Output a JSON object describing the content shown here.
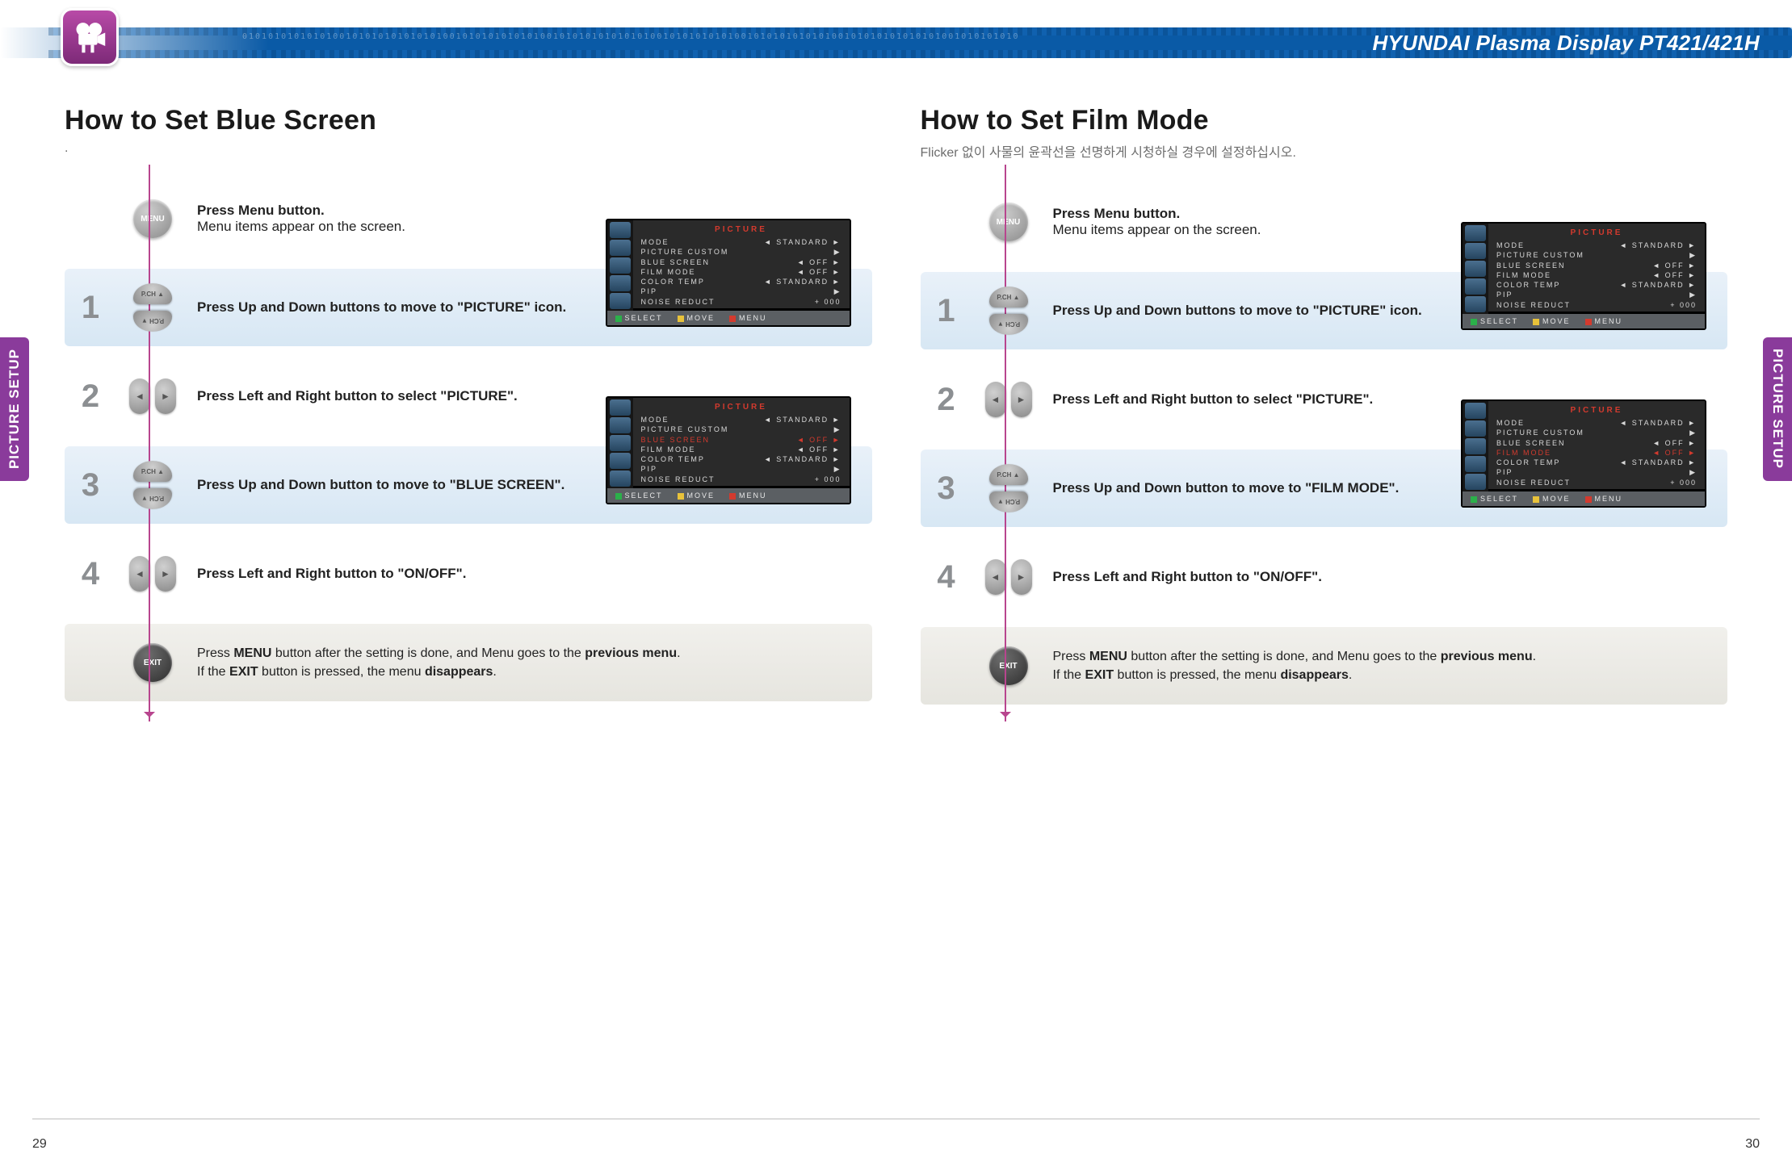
{
  "header": {
    "product_title": "HYUNDAI Plasma Display PT421/421H",
    "binary_decor": "010101010101010010101010101010100101010101010100101010101010101001010101010100101010101010100101010101010101001010101010"
  },
  "side_tab": {
    "label": "PICTURE SETUP"
  },
  "buttons": {
    "menu": "MENU",
    "exit": "EXIT",
    "pch_up": "P.CH ▲",
    "pch_down": "P.CH ▼",
    "left": "◄",
    "right": "►"
  },
  "osd": {
    "title": "PICTURE",
    "footer": {
      "select": "SELECT",
      "move": "MOVE",
      "menu": "MENU"
    },
    "rows_base": [
      {
        "k": "MODE",
        "v": "◄  STANDARD  ►"
      },
      {
        "k": "PICTURE  CUSTOM",
        "v": "▶"
      },
      {
        "k": "BLUE  SCREEN",
        "v": "◄     OFF     ►"
      },
      {
        "k": "FILM  MODE",
        "v": "◄     OFF     ►"
      },
      {
        "k": "COLOR  TEMP",
        "v": "◄  STANDARD  ►"
      },
      {
        "k": "PIP",
        "v": "▶"
      },
      {
        "k": "NOISE  REDUCT",
        "v": "+ 000"
      }
    ],
    "highlight_blue": "BLUE  SCREEN",
    "highlight_film": "FILM  MODE"
  },
  "left": {
    "title": "How to Set Blue Screen",
    "subtitle": ".",
    "intro": {
      "bold": "Press Menu button.",
      "rest": "Menu items appear on the screen."
    },
    "steps": [
      {
        "n": "1",
        "text_bold": "Press Up and Down buttons to move to \"PICTURE\" icon.",
        "icon": "updown",
        "bg": "blue"
      },
      {
        "n": "2",
        "text_bold": "Press Left and Right button to select \"PICTURE\".",
        "icon": "lr",
        "bg": "none"
      },
      {
        "n": "3",
        "text_bold": "Press Up and Down button to move to \"BLUE SCREEN\".",
        "icon": "updown",
        "bg": "blue"
      },
      {
        "n": "4",
        "text_bold": "Press Left and Right button to \"ON/OFF\".",
        "icon": "lr",
        "bg": "none"
      }
    ],
    "exit": {
      "line1_pre": "Press ",
      "line1_b1": "MENU",
      "line1_mid": " button after the setting is done, and Menu goes to the ",
      "line1_b2": "previous menu",
      "line1_post": ".",
      "line2_pre": "If the ",
      "line2_b": "EXIT",
      "line2_mid": " button is pressed, the menu ",
      "line2_b2": "disappears",
      "line2_post": "."
    }
  },
  "right": {
    "title": "How to Set Film Mode",
    "subtitle": "Flicker 없이 사물의 윤곽선을 선명하게 시청하실 경우에 설정하십시오.",
    "intro": {
      "bold": "Press Menu button.",
      "rest": "Menu items appear on the screen."
    },
    "steps": [
      {
        "n": "1",
        "text_bold": "Press Up and Down buttons to move to \"PICTURE\" icon.",
        "icon": "updown",
        "bg": "blue"
      },
      {
        "n": "2",
        "text_bold": "Press Left and Right button to select \"PICTURE\".",
        "icon": "lr",
        "bg": "none"
      },
      {
        "n": "3",
        "text_bold": "Press Up and Down button to move to \"FILM MODE\".",
        "icon": "updown",
        "bg": "blue"
      },
      {
        "n": "4",
        "text_bold": "Press Left and Right button to \"ON/OFF\".",
        "icon": "lr",
        "bg": "none"
      }
    ],
    "exit": {
      "line1_pre": "Press ",
      "line1_b1": "MENU",
      "line1_mid": " button after the setting is done, and Menu goes to the ",
      "line1_b2": "previous menu",
      "line1_post": ".",
      "line2_pre": "If the ",
      "line2_b": "EXIT",
      "line2_mid": " button is pressed, the menu ",
      "line2_b2": "disappears",
      "line2_post": "."
    }
  },
  "pagenums": {
    "left": "29",
    "right": "30"
  }
}
